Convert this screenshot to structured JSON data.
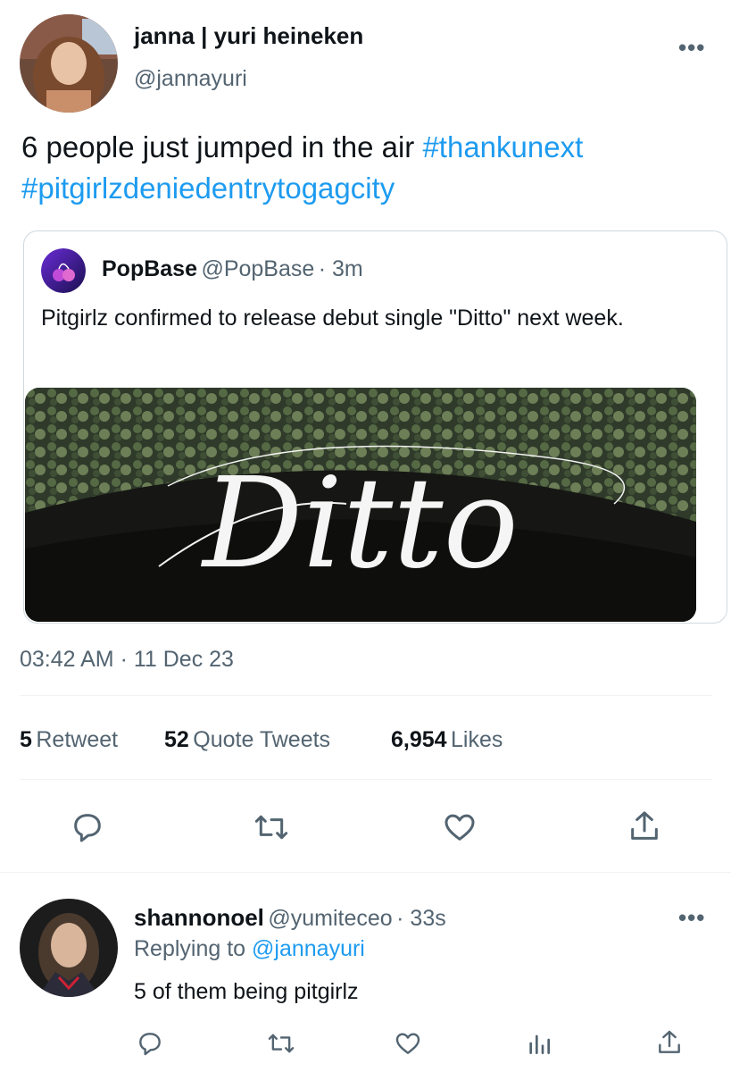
{
  "tweet": {
    "author_name": "janna | yuri heineken",
    "author_handle": "@jannayuri",
    "more_label": "•••",
    "text_plain": "6 people just jumped in the air ",
    "hashtag_1": "#thankunext",
    "hashtag_2": "#pitgirlzdeniedentrytogagcity",
    "timestamp": "03:42 AM · 11 Dec 23"
  },
  "quote": {
    "name": "PopBase",
    "handle": "@PopBase",
    "time": "· 3m",
    "text": "Pitgirlz confirmed to release debut single \"Ditto\" next week.",
    "media_title": "Ditto"
  },
  "stats": {
    "retweets_count": "5",
    "retweets_label": "Retweet",
    "quotes_count": "52",
    "quotes_label": "Quote Tweets",
    "likes_count": "6,954",
    "likes_label": "Likes"
  },
  "actions": [
    "reply-icon",
    "retweet-icon",
    "like-icon",
    "share-icon"
  ],
  "reply": {
    "author_name": "shannonoel",
    "author_handle": "@yumiteceo",
    "time": "· 33s",
    "more_label": "•••",
    "replying_prefix": "Replying to",
    "replying_to": "@jannayuri",
    "text": "5 of them being pitgirlz"
  },
  "reply_actions": [
    "reply-icon",
    "retweet-icon",
    "like-icon",
    "analytics-icon",
    "share-icon"
  ],
  "colors": {
    "link": "#1d9bf0",
    "muted": "#536471",
    "text": "#0f1419",
    "border": "#cfd9de"
  }
}
